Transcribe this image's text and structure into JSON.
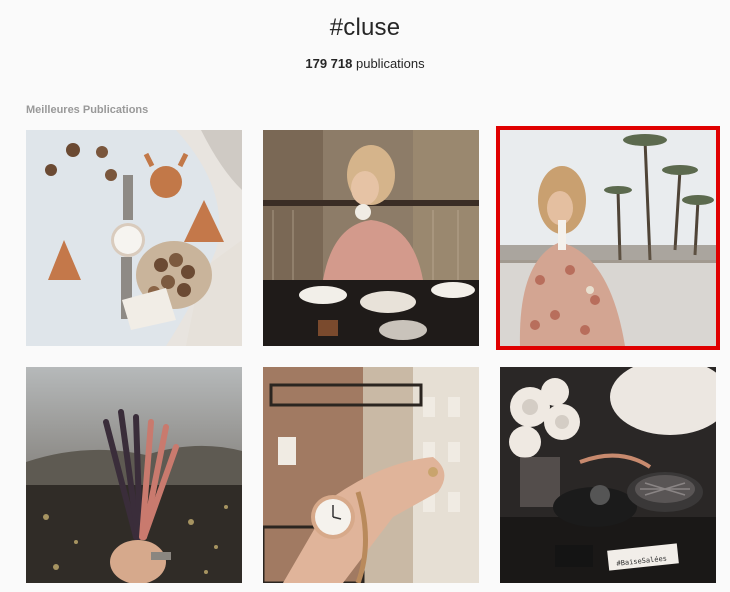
{
  "header": {
    "hashtag": "#cluse",
    "count_number": "179 718",
    "count_label": "publications"
  },
  "section": {
    "title": "Meilleures Publications"
  },
  "posts": [
    {
      "description": "flatlay-watch-gingerbread",
      "selected": false
    },
    {
      "description": "woman-cafe-tea",
      "selected": false
    },
    {
      "description": "woman-palm-trees-drink",
      "selected": true
    },
    {
      "description": "hand-lavender-bouquet",
      "selected": false
    },
    {
      "description": "wrist-watch-bracelets-street",
      "selected": false
    },
    {
      "description": "watch-box-flowers",
      "selected": false
    }
  ],
  "image_text": {
    "card_signature": "#BaiseSalées"
  },
  "colors": {
    "highlight": "#e00000",
    "background": "#fafafa"
  }
}
